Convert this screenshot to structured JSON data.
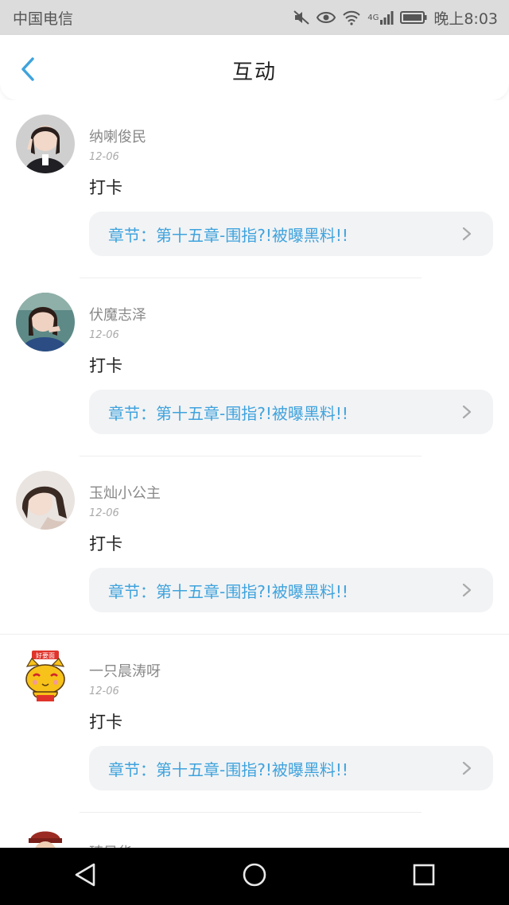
{
  "status_bar": {
    "carrier": "中国电信",
    "network": "4G",
    "time": "晚上8:03"
  },
  "header": {
    "title": "互动"
  },
  "feed": [
    {
      "user": "纳喇俊民",
      "date": "12-06",
      "content": "打卡",
      "chapter": "章节：第十五章-围指?!被曝黑料!!"
    },
    {
      "user": "伏魔志泽",
      "date": "12-06",
      "content": "打卡",
      "chapter": "章节：第十五章-围指?!被曝黑料!!"
    },
    {
      "user": "玉灿小公主",
      "date": "12-06",
      "content": "打卡",
      "chapter": "章节：第十五章-围指?!被曝黑料!!"
    },
    {
      "user": "一只晨涛呀",
      "date": "12-06",
      "content": "打卡",
      "chapter": "章节：第十五章-围指?!被曝黑料!!",
      "avatar_badge": "好要面"
    },
    {
      "user": "琦风华"
    }
  ],
  "colors": {
    "accent": "#3fa3dd",
    "status_bar_bg": "#dcdcdc",
    "chapter_bg": "#f2f3f5"
  },
  "icons": {
    "back": "chevron-left-icon",
    "chapter_arrow": "chevron-right-icon",
    "nav_back": "triangle-back-icon",
    "nav_home": "circle-home-icon",
    "nav_recent": "square-recent-icon"
  }
}
